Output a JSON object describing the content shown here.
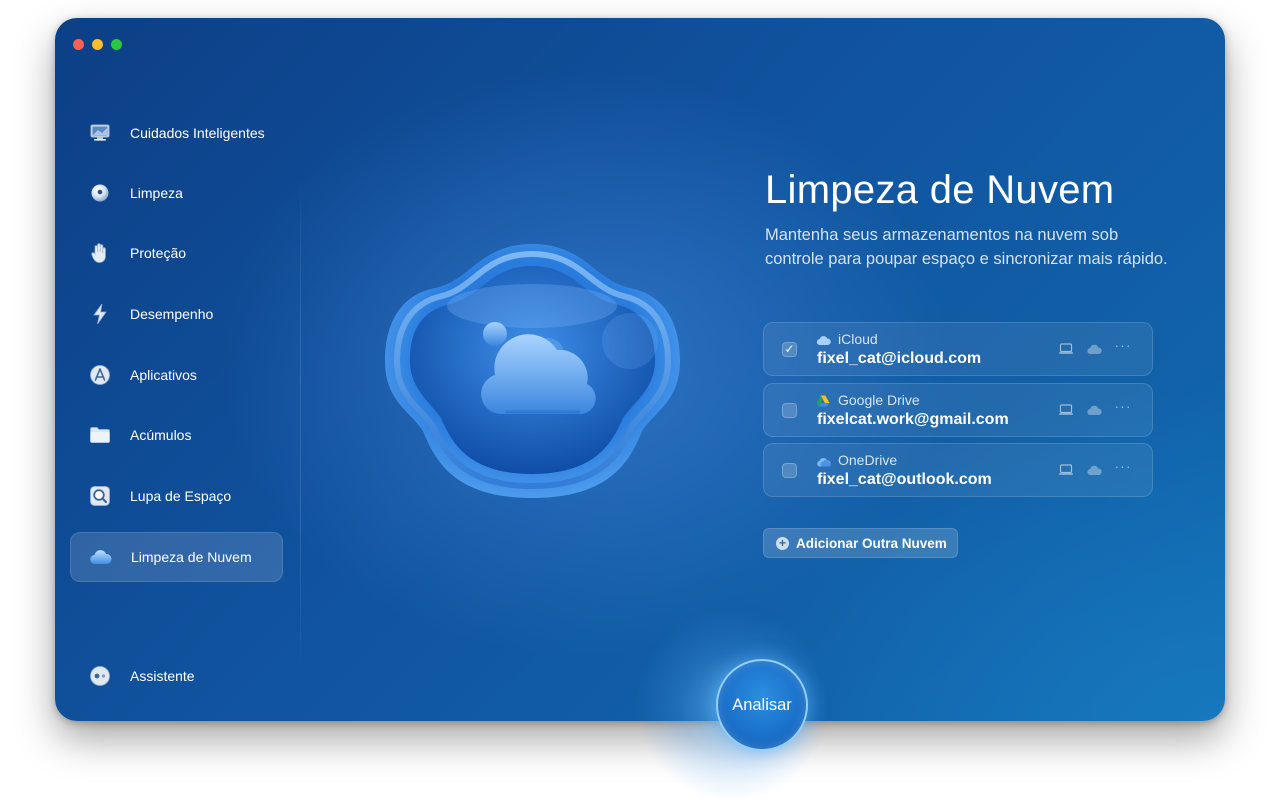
{
  "window": {
    "traffic_lights": [
      "close",
      "minimize",
      "zoom"
    ]
  },
  "sidebar": {
    "items": [
      {
        "label": "Cuidados Inteligentes",
        "icon": "monitor-icon",
        "active": false
      },
      {
        "label": "Limpeza",
        "icon": "sphere-icon",
        "active": false
      },
      {
        "label": "Proteção",
        "icon": "hand-icon",
        "active": false
      },
      {
        "label": "Desempenho",
        "icon": "lightning-icon",
        "active": false
      },
      {
        "label": "Aplicativos",
        "icon": "apps-icon",
        "active": false
      },
      {
        "label": "Acúmulos",
        "icon": "folder-icon",
        "active": false
      },
      {
        "label": "Lupa de Espaço",
        "icon": "space-lens-icon",
        "active": false
      },
      {
        "label": "Limpeza de Nuvem",
        "icon": "cloud-icon",
        "active": true
      }
    ],
    "assistant": {
      "label": "Assistente",
      "icon": "assistant-icon"
    }
  },
  "main": {
    "title": "Limpeza de Nuvem",
    "subtitle": "Mantenha seus armazenamentos na nuvem sob controle para poupar espaço e sincronizar mais rápido.",
    "accounts": [
      {
        "service": "iCloud",
        "email": "fixel_cat@icloud.com",
        "checked": true,
        "icon": "icloud-icon"
      },
      {
        "service": "Google Drive",
        "email": "fixelcat.work@gmail.com",
        "checked": false,
        "icon": "google-drive-icon"
      },
      {
        "service": "OneDrive",
        "email": "fixel_cat@outlook.com",
        "checked": false,
        "icon": "onedrive-icon"
      }
    ],
    "add_button": "Adicionar Outra Nuvem",
    "scan_button": "Analisar"
  },
  "colors": {
    "background_start": "#0c3f86",
    "background_end": "#0f6db2",
    "accent": "#1a6fc8",
    "text": "#ffffff"
  }
}
